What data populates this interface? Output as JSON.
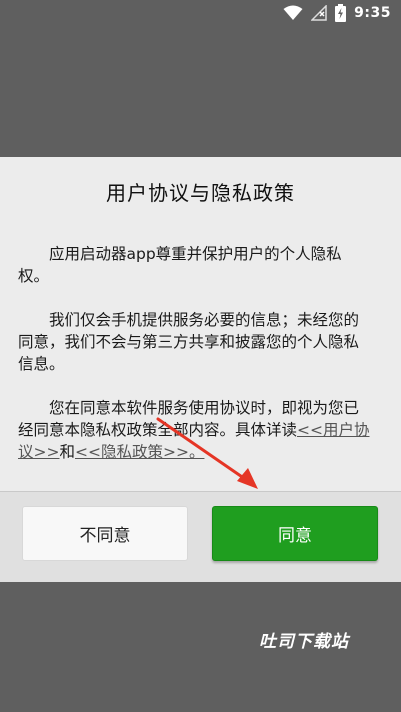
{
  "status_bar": {
    "time": "9:35",
    "icons": [
      "wifi-icon",
      "signal-off-icon",
      "battery-charging-icon"
    ]
  },
  "dialog": {
    "title": "用户协议与隐私政策",
    "paragraph1": "应用启动器app尊重并保护用户的个人隐私权。",
    "paragraph2": "我们仅会手机提供服务必要的信息；未经您的同意，我们不会与第三方共享和披露您的个人隐私信息。",
    "paragraph3_before": "您在同意本软件服务使用协议时，即视为您已经同意本隐私权政策全部内容。具体详读",
    "user_agreement_link": "<<用户协议>>",
    "paragraph3_and": "和",
    "privacy_policy_link": "<<隐私政策>>。",
    "disagree_label": "不同意",
    "agree_label": "同意"
  },
  "watermark": "吐司下载站",
  "colors": {
    "backdrop": "#5f5f5f",
    "dialog_bg": "#ececec",
    "agree_green": "#1f9e1f",
    "annotation_red": "#e53525"
  }
}
